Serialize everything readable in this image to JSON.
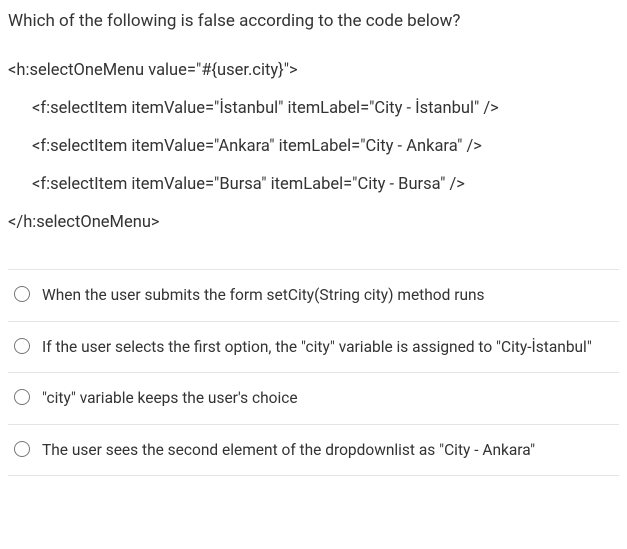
{
  "question": "Which of the following is false according to the code below?",
  "code": {
    "line1": "<h:selectOneMenu value=\"#{user.city}\">",
    "line2": "<f:selectItem itemValue=\"İstanbul\" itemLabel=\"City - İstanbul\" />",
    "line3": "<f:selectItem itemValue=\"Ankara\" itemLabel=\"City - Ankara\" />",
    "line4": "<f:selectItem itemValue=\"Bursa\" itemLabel=\"City - Bursa\" />",
    "line5": "</h:selectOneMenu>"
  },
  "options": [
    {
      "text": "When the user submits the form setCity(String city) method runs"
    },
    {
      "text": "If the user selects the first option, the \"city\" variable is assigned to \"City-İstanbul\""
    },
    {
      "text": "\"city\" variable keeps the user's choice"
    },
    {
      "text": "The user sees the second element of the dropdownlist as \"City - Ankara\""
    }
  ]
}
